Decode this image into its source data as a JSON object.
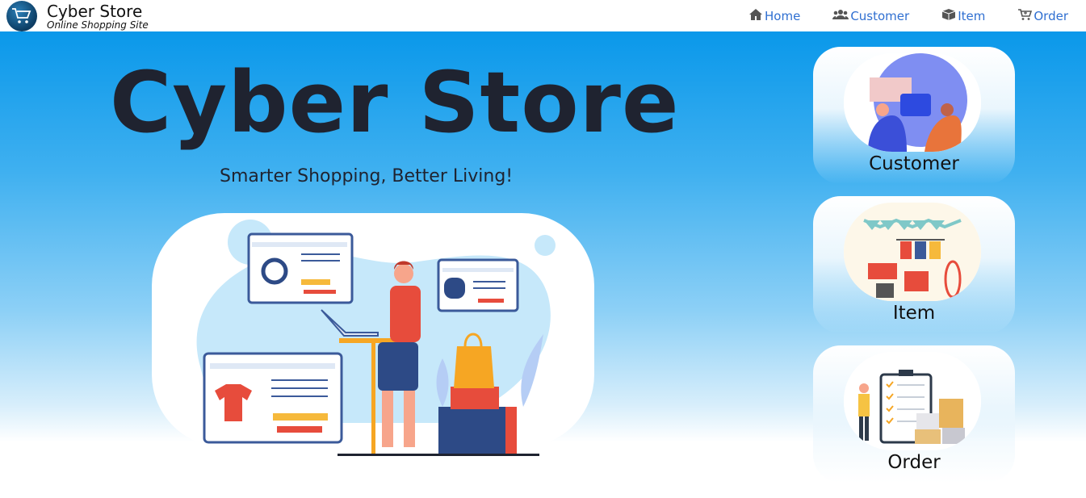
{
  "brand": {
    "title": "Cyber Store",
    "subtitle": "Online Shopping Site",
    "logo_icon": "cart-icon"
  },
  "nav": {
    "items": [
      {
        "label": "Home",
        "icon": "home-icon"
      },
      {
        "label": "Customer",
        "icon": "users-icon"
      },
      {
        "label": "Item",
        "icon": "box-icon"
      },
      {
        "label": "Order",
        "icon": "cart-icon"
      }
    ]
  },
  "hero": {
    "title": "Cyber Store",
    "tagline": "Smarter Shopping, Better Living!"
  },
  "cards": [
    {
      "label": "Customer"
    },
    {
      "label": "Item"
    },
    {
      "label": "Order"
    }
  ],
  "colors": {
    "accent": "#2f6fd1",
    "hero_top": "#0a98ea",
    "text": "#1f2330"
  }
}
